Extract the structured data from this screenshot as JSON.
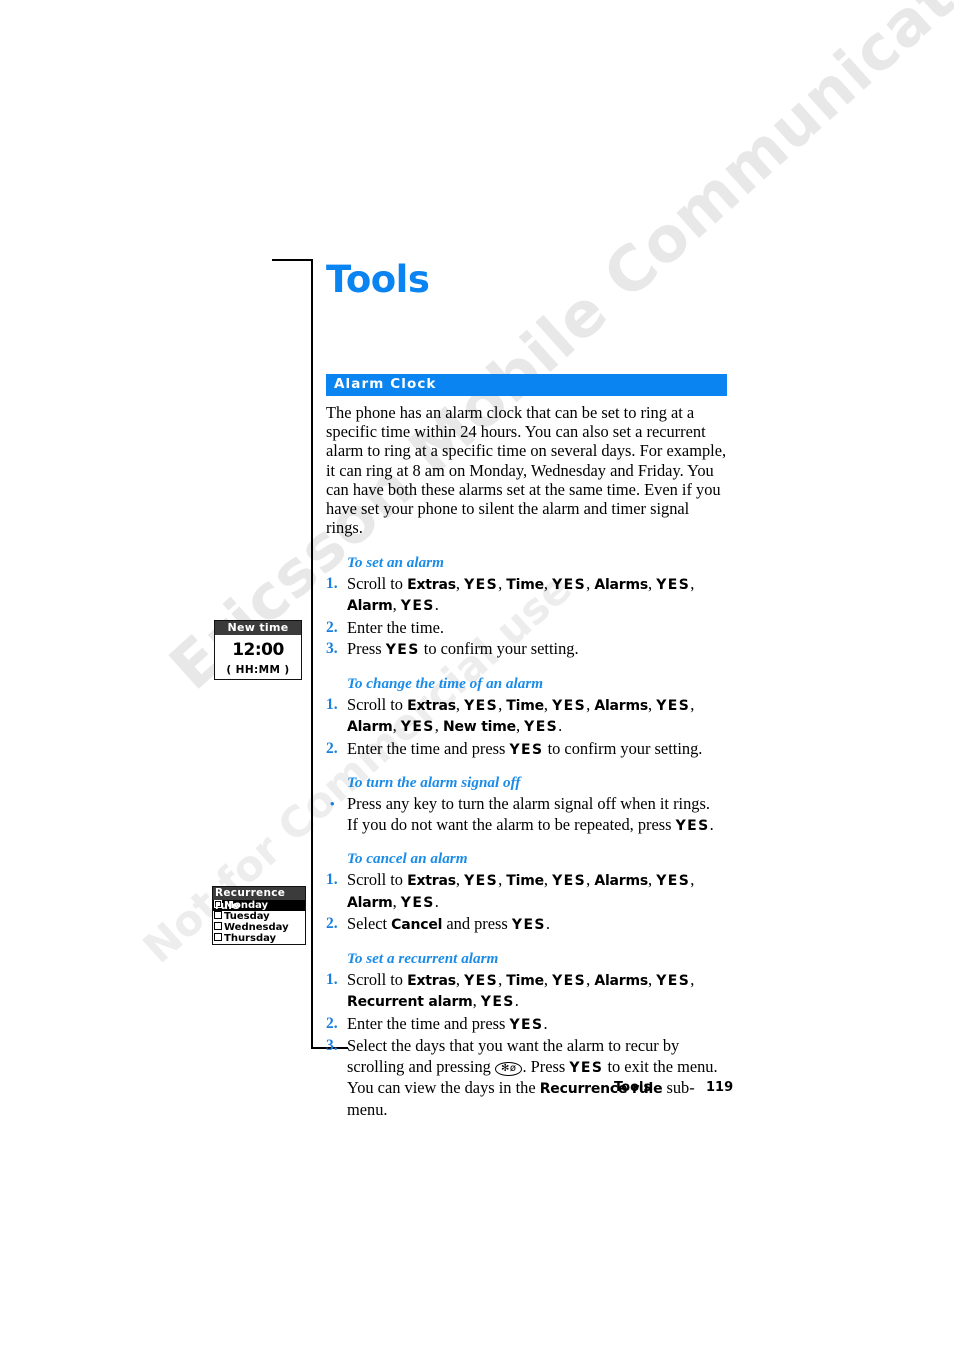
{
  "page": {
    "title": "Tools",
    "footer_section": "Tools",
    "footer_page_number": "119",
    "watermark_line1": "Ericsson Mobile Communications AB",
    "watermark_line2": "Not for Commercial use",
    "accent_color": "#0a84f0",
    "heading_color": "#1a8ce8"
  },
  "section": {
    "bar_title": "Alarm Clock",
    "intro": "The phone has an alarm clock that can be set to ring at a specific time within 24 hours. You can also set a recurrent alarm to ring at a specific time on several days. For example, it can ring at 8 am on Monday, Wednesday and Friday. You can have both these alarms set at the same time. Even if you have set your phone to silent the alarm and timer signal rings."
  },
  "procedures": [
    {
      "title": "To set an alarm",
      "steps": [
        {
          "marker": "1.",
          "text_html": "Scroll to <b class=\"menu\">Extras</b>, <b class=\"key\">YES</b>, <b class=\"menu\">Time</b>, <b class=\"key\">YES</b>, <b class=\"menu\">Alarms</b>, <b class=\"key\">YES</b>, <b class=\"menu\">Alarm</b>, <b class=\"key\">YES</b>."
        },
        {
          "marker": "2.",
          "text_html": "Enter the time."
        },
        {
          "marker": "3.",
          "text_html": "Press <b class=\"key\">YES</b> to confirm your setting."
        }
      ]
    },
    {
      "title": "To change the time of an alarm",
      "steps": [
        {
          "marker": "1.",
          "text_html": "Scroll to <b class=\"menu\">Extras</b>, <b class=\"key\">YES</b>, <b class=\"menu\">Time</b>, <b class=\"key\">YES</b>, <b class=\"menu\">Alarms</b>, <b class=\"key\">YES</b>, <b class=\"menu\">Alarm</b>, <b class=\"key\">YES</b>, <b class=\"menu\">New time</b>, <b class=\"key\">YES</b>."
        },
        {
          "marker": "2.",
          "text_html": "Enter the time and press <b class=\"key\">YES</b> to confirm your setting."
        }
      ]
    },
    {
      "title": "To turn the alarm signal off",
      "steps": [
        {
          "marker": "•",
          "bullet": true,
          "text_html": "Press any key to turn the alarm signal off when it rings.<br>If you do not want the alarm to be repeated, press <b class=\"key\">YES</b>."
        }
      ]
    },
    {
      "title": "To cancel an alarm",
      "steps": [
        {
          "marker": "1.",
          "text_html": "Scroll to <b class=\"menu\">Extras</b>, <b class=\"key\">YES</b>, <b class=\"menu\">Time</b>, <b class=\"key\">YES</b>, <b class=\"menu\">Alarms</b>, <b class=\"key\">YES</b>, <b class=\"menu\">Alarm</b>, <b class=\"key\">YES</b>."
        },
        {
          "marker": "2.",
          "text_html": "Select <b class=\"menu\">Cancel</b> and press <b class=\"key\">YES</b>."
        }
      ]
    },
    {
      "title": "To set a recurrent alarm",
      "steps": [
        {
          "marker": "1.",
          "text_html": "Scroll to <b class=\"menu\">Extras</b>, <b class=\"key\">YES</b>, <b class=\"menu\">Time</b>, <b class=\"key\">YES</b>, <b class=\"menu\">Alarms</b>, <b class=\"key\">YES</b>, <b class=\"menu\">Recurrent alarm</b>, <b class=\"key\">YES</b>."
        },
        {
          "marker": "2.",
          "text_html": "Enter the time and press <b class=\"key\">YES</b>."
        },
        {
          "marker": "3.",
          "text_html": "Select the days that you want the alarm to recur by scrolling and pressing <span class=\"keyglyph\">✻ø</span>. Press <b class=\"key\">YES</b> to exit the menu.<br>You can view the days in the <b class=\"menu\">Recurrence rule</b> sub-menu."
        }
      ]
    }
  ],
  "figures": {
    "new_time": {
      "header": "New time",
      "value": "12:00",
      "format_hint": "( HH:MM )"
    },
    "recurrence_rule": {
      "header": "Recurrence rule",
      "rows": [
        {
          "label": "Monday",
          "checked": true,
          "selected": true
        },
        {
          "label": "Tuesday",
          "checked": false,
          "selected": false
        },
        {
          "label": "Wednesday",
          "checked": false,
          "selected": false
        },
        {
          "label": "Thursday",
          "checked": false,
          "selected": false
        }
      ]
    }
  }
}
